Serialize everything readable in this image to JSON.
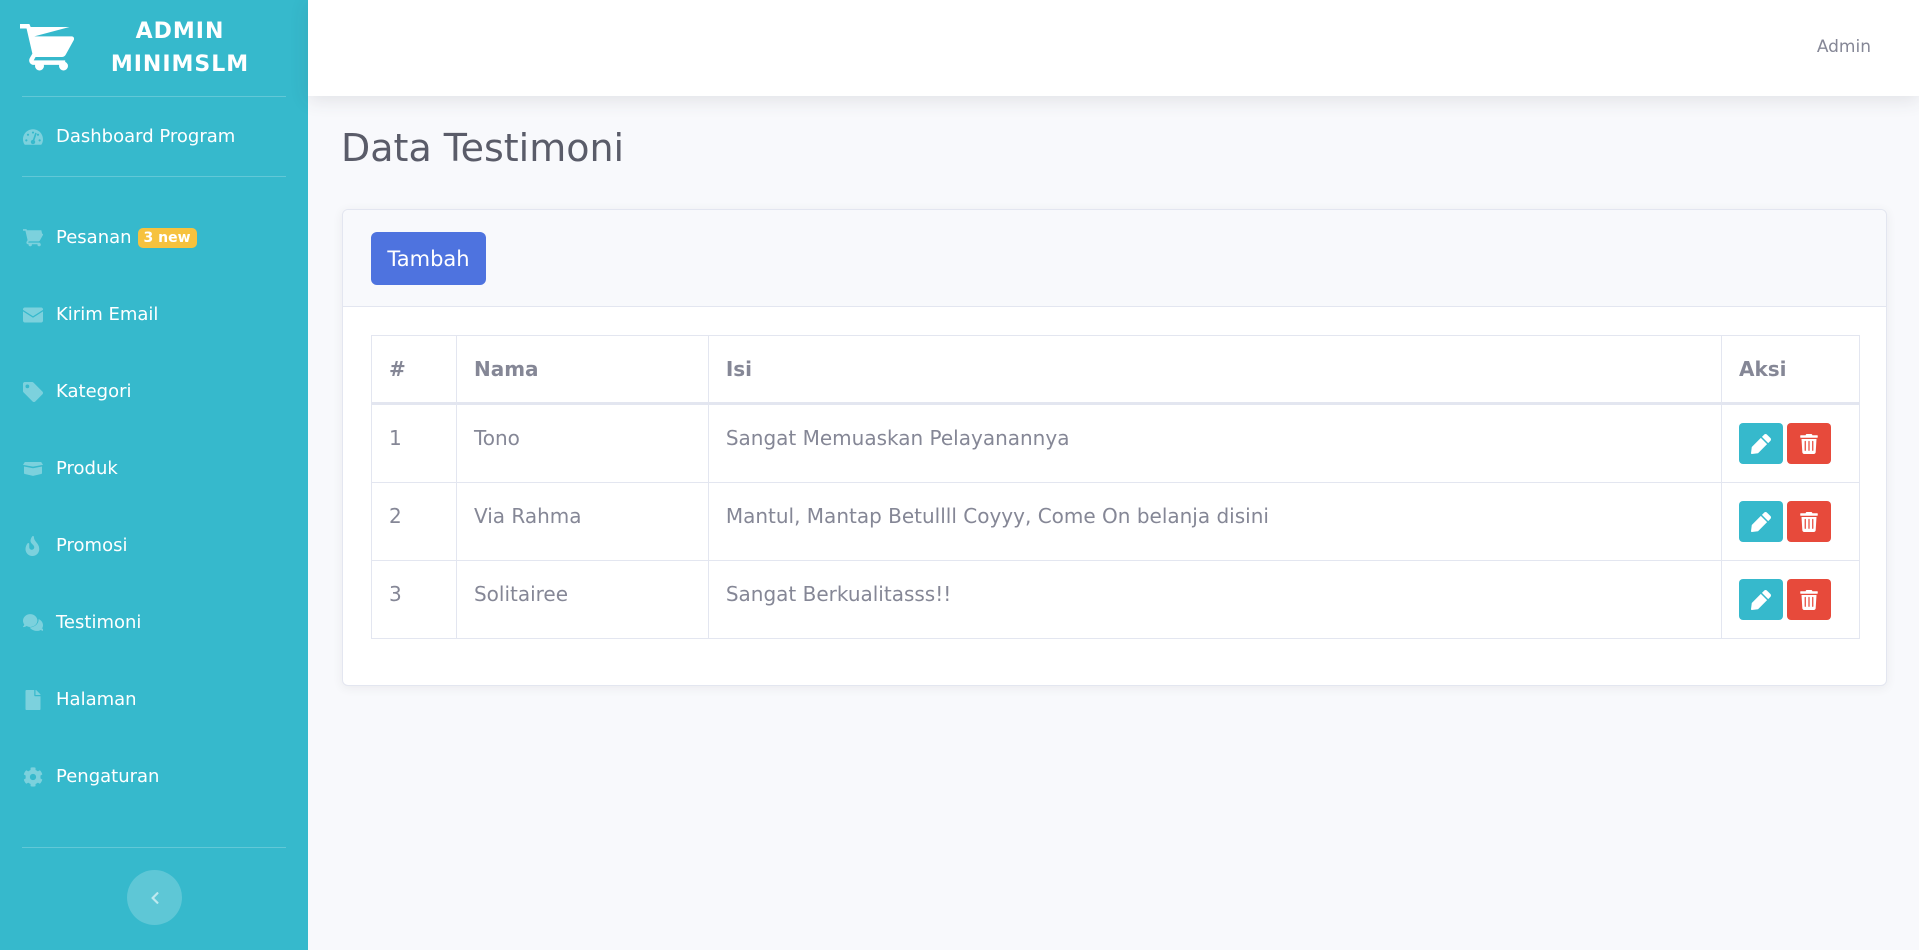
{
  "sidebar": {
    "brand_line1": "ADMIN",
    "brand_line2": "MINIMSLM",
    "dashboard": "Dashboard Program",
    "items": [
      {
        "label": "Pesanan",
        "badge": "3 new",
        "icon": "cart-icon"
      },
      {
        "label": "Kirim Email",
        "icon": "envelope-icon"
      },
      {
        "label": "Kategori",
        "icon": "tag-icon"
      },
      {
        "label": "Produk",
        "icon": "box-icon"
      },
      {
        "label": "Promosi",
        "icon": "fire-icon"
      },
      {
        "label": "Testimoni",
        "icon": "comments-icon"
      },
      {
        "label": "Halaman",
        "icon": "file-icon"
      },
      {
        "label": "Pengaturan",
        "icon": "gear-icon"
      }
    ]
  },
  "topbar": {
    "user": "Admin"
  },
  "page": {
    "title": "Data Testimoni",
    "add_label": "Tambah"
  },
  "table": {
    "headers": [
      "#",
      "Nama",
      "Isi",
      "Aksi"
    ],
    "rows": [
      {
        "no": "1",
        "nama": "Tono",
        "isi": "Sangat Memuaskan Pelayanannya"
      },
      {
        "no": "2",
        "nama": "Via Rahma",
        "isi": "Mantul, Mantap Betullll Coyyy, Come On belanja disini"
      },
      {
        "no": "3",
        "nama": "Solitairee",
        "isi": "Sangat Berkualitasss!!"
      }
    ]
  },
  "colors": {
    "sidebar": "#36b9cc",
    "primary": "#4e73df",
    "info": "#36b9cc",
    "danger": "#e74a3b",
    "warning": "#f6c23e"
  }
}
